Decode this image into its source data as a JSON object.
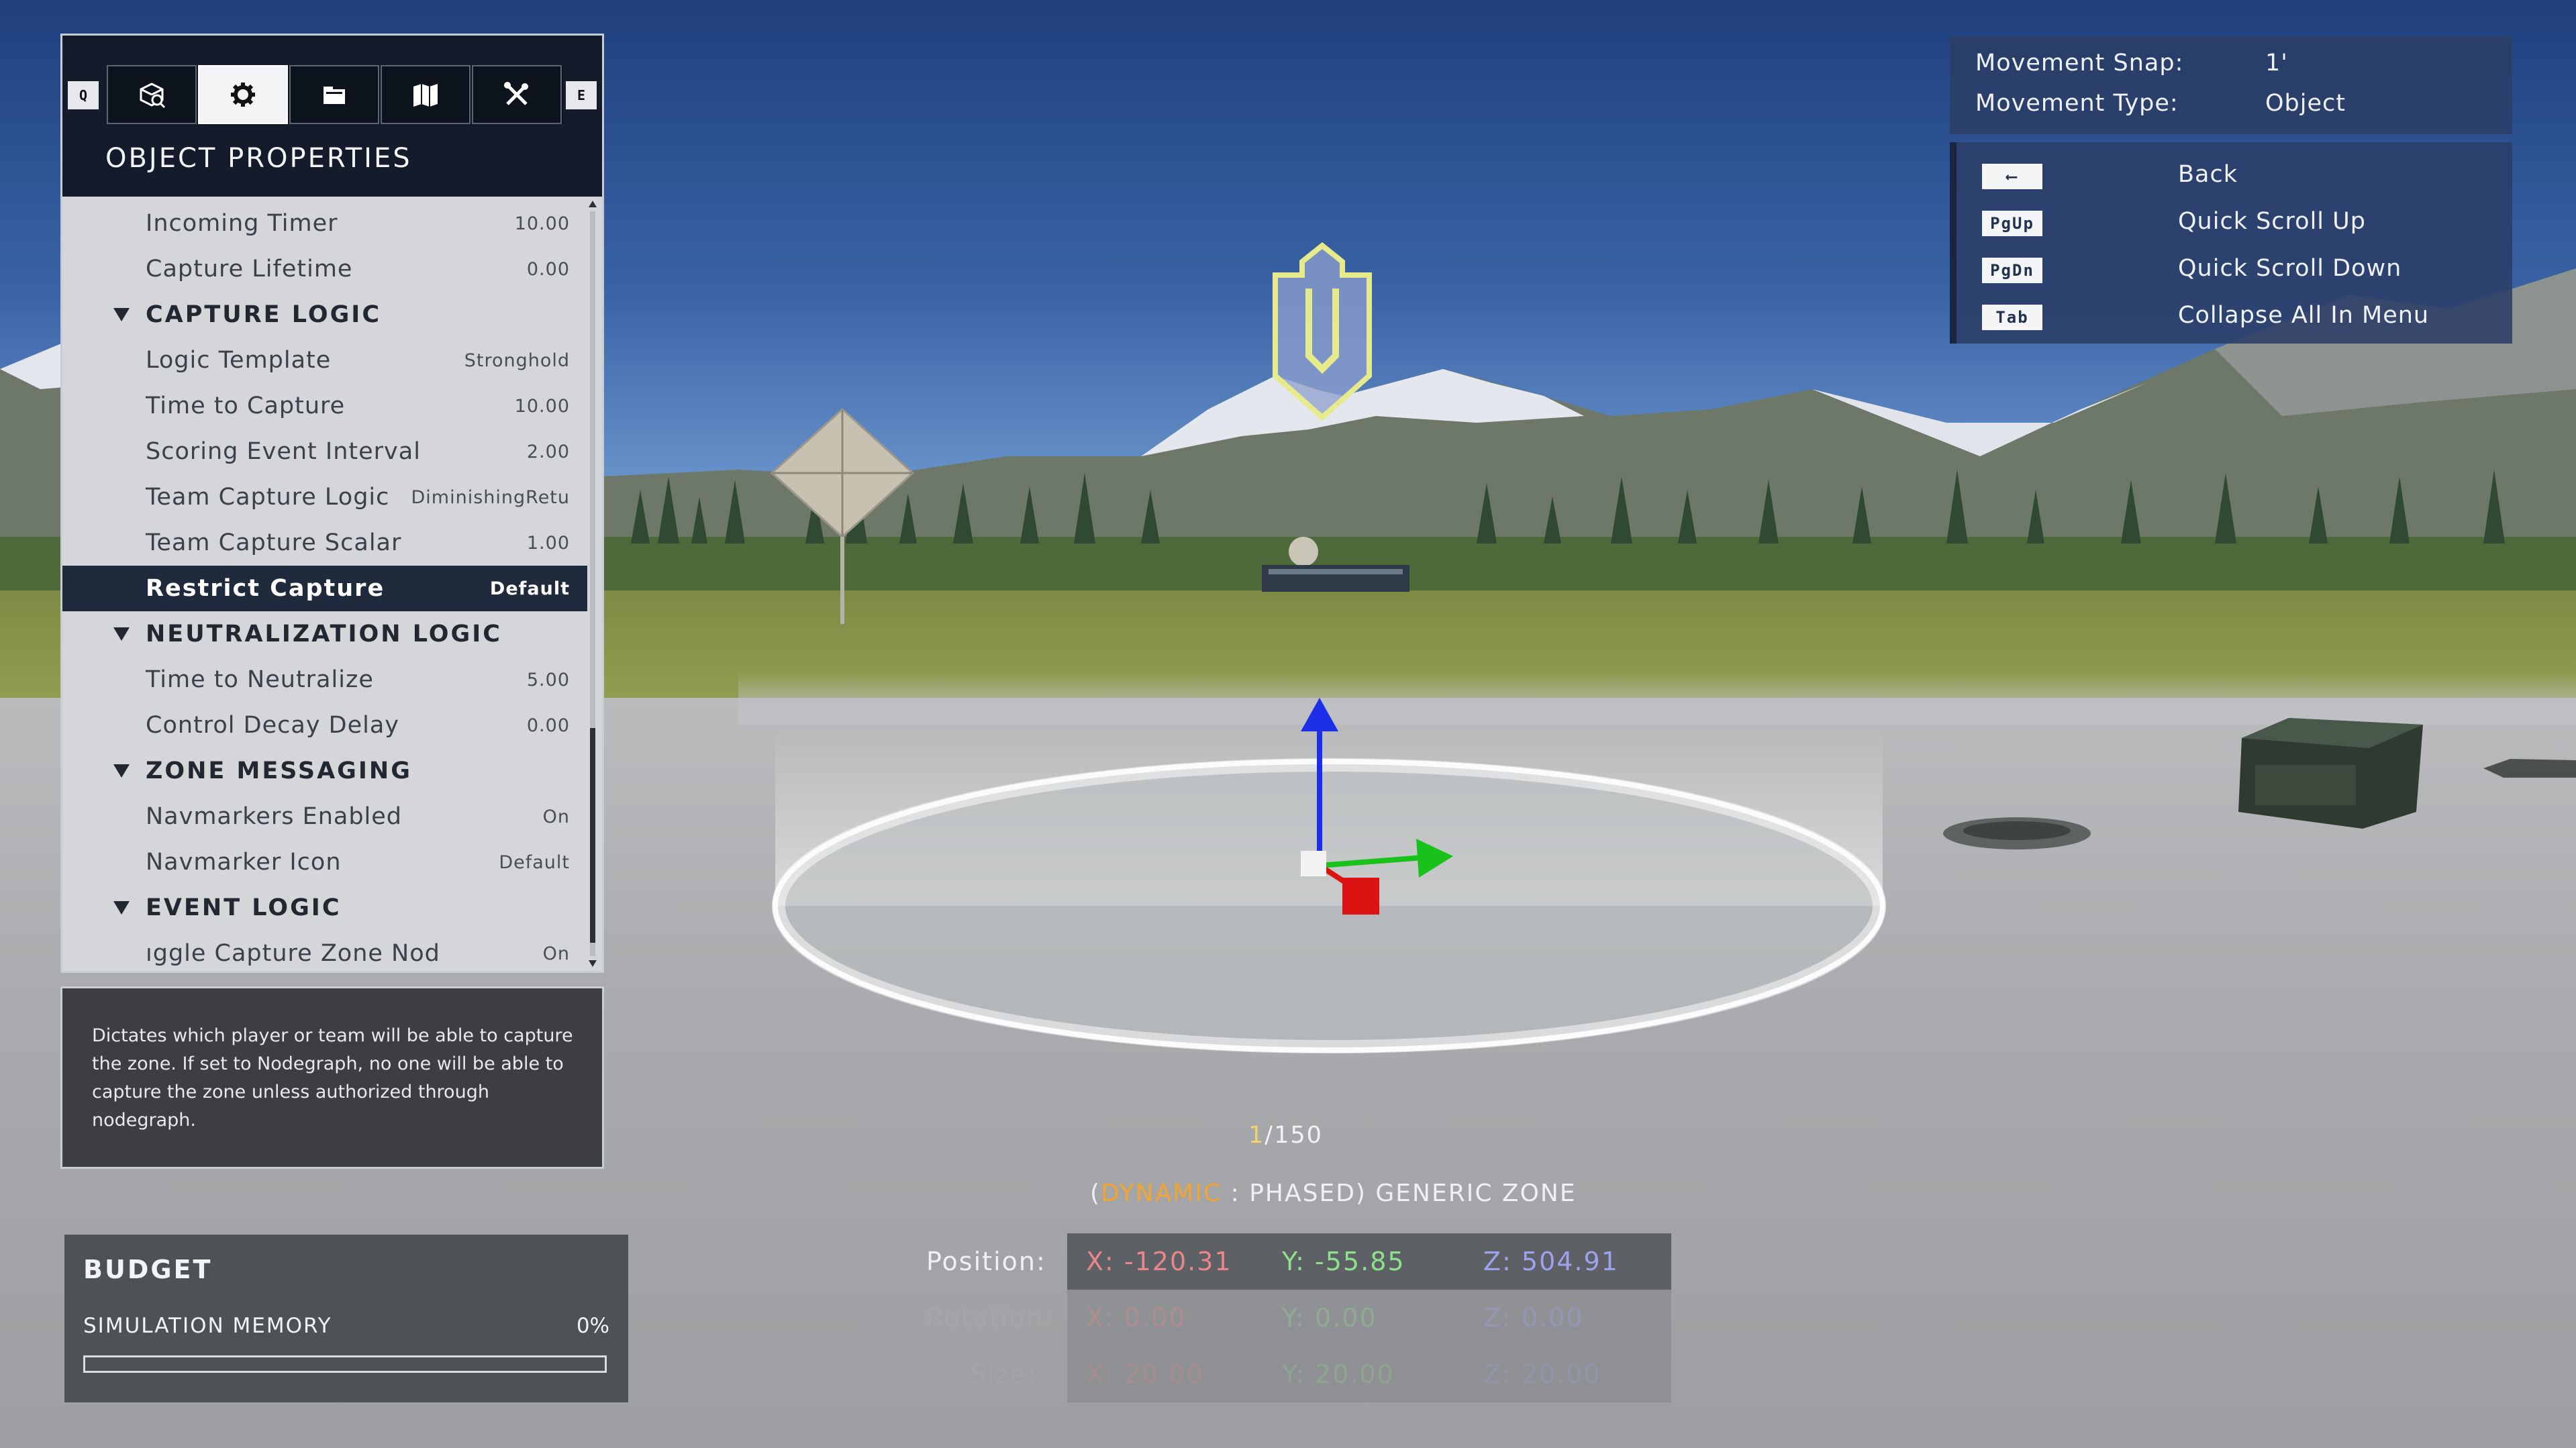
{
  "window": {
    "title": "OBJECT PROPERTIES"
  },
  "tab_keys": {
    "left": "Q",
    "right": "E"
  },
  "tabs": [
    {
      "icon": "object-browser-icon",
      "active": false
    },
    {
      "icon": "gear-icon",
      "active": true
    },
    {
      "icon": "folder-icon",
      "active": false
    },
    {
      "icon": "map-icon",
      "active": false
    },
    {
      "icon": "tools-icon",
      "active": false
    }
  ],
  "properties": [
    {
      "label": "Incoming Timer",
      "value": "10.00",
      "kind": "item"
    },
    {
      "label": "Capture Lifetime",
      "value": "0.00",
      "kind": "item"
    },
    {
      "label": "CAPTURE LOGIC",
      "value": "",
      "kind": "section"
    },
    {
      "label": "Logic Template",
      "value": "Stronghold",
      "kind": "item"
    },
    {
      "label": "Time to Capture",
      "value": "10.00",
      "kind": "item"
    },
    {
      "label": "Scoring Event Interval",
      "value": "2.00",
      "kind": "item"
    },
    {
      "label": "Team Capture Logic",
      "value": "DiminishingRetu",
      "kind": "item"
    },
    {
      "label": "Team Capture Scalar",
      "value": "1.00",
      "kind": "item"
    },
    {
      "label": "Restrict Capture",
      "value": "Default",
      "kind": "selected"
    },
    {
      "label": "NEUTRALIZATION LOGIC",
      "value": "",
      "kind": "section"
    },
    {
      "label": "Time to Neutralize",
      "value": "5.00",
      "kind": "item"
    },
    {
      "label": "Control Decay Delay",
      "value": "0.00",
      "kind": "item"
    },
    {
      "label": "ZONE MESSAGING",
      "value": "",
      "kind": "section"
    },
    {
      "label": "Navmarkers Enabled",
      "value": "On",
      "kind": "item"
    },
    {
      "label": "Navmarker Icon",
      "value": "Default",
      "kind": "item"
    },
    {
      "label": "EVENT LOGIC",
      "value": "",
      "kind": "section"
    },
    {
      "label": "ıggle Capture Zone Nod",
      "value": "On",
      "kind": "item"
    }
  ],
  "description": "Dictates which player or team will be able to capture the zone. If set to Nodegraph, no one will be able to capture the zone unless authorized through nodegraph.",
  "budget": {
    "title": "BUDGET",
    "label": "SIMULATION MEMORY",
    "percent_text": "0%",
    "fill_fraction": 0
  },
  "snap": {
    "movement_snap_label": "Movement Snap:",
    "movement_snap_value": "1'",
    "movement_type_label": "Movement Type:",
    "movement_type_value": "Object"
  },
  "shortcuts": [
    {
      "key": "⟵",
      "label": "Back"
    },
    {
      "key": "PgUp",
      "label": "Quick Scroll Up"
    },
    {
      "key": "PgDn",
      "label": "Quick Scroll Down"
    },
    {
      "key": "Tab",
      "label": "Collapse All In Menu"
    }
  ],
  "counter": {
    "current": "1",
    "total": "/150"
  },
  "object_name": {
    "open": "(",
    "dynamic": "DYNAMIC",
    "rest": " : PHASED) GENERIC ZONE"
  },
  "transform": {
    "position_label": "Position:",
    "rotation_label": "Rotation:",
    "size_label": "Size:",
    "position": {
      "x": "X: -120.31",
      "y": "Y: -55.85",
      "z": "Z: 504.91"
    },
    "rotation": {
      "x": "X: 0.00",
      "y": "Y: 0.00",
      "z": "Z: 0.00"
    },
    "size": {
      "x": "X: 20.00",
      "y": "Y: 20.00",
      "z": "Z: 20.00"
    }
  },
  "colors": {
    "x_axis": "#e8868a",
    "y_axis": "#8fe08c",
    "z_axis": "#9ea2ee",
    "dynamic": "#f3a531",
    "counter_current": "#f3d36b"
  }
}
